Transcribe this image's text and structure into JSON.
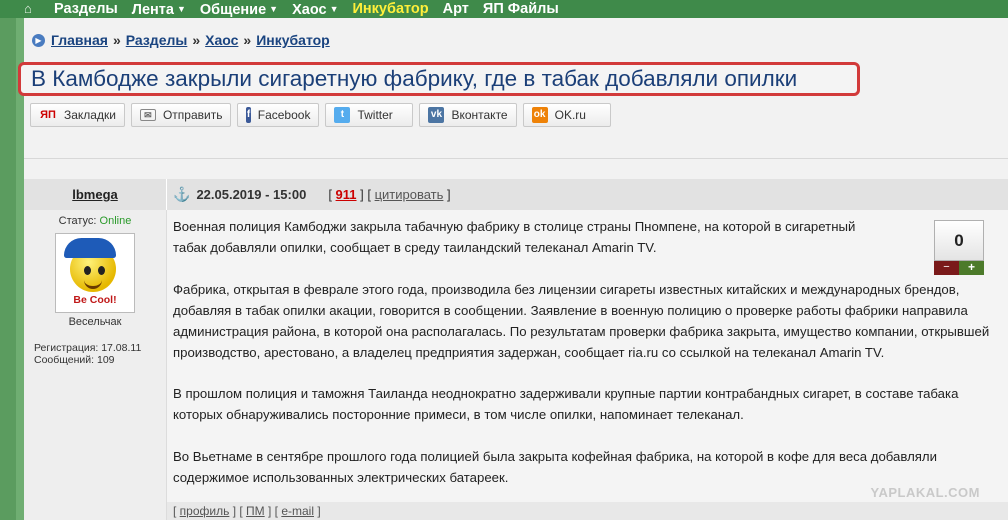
{
  "topnav": {
    "home_icon": "home-icon",
    "items": [
      {
        "label": "Разделы",
        "caret": false
      },
      {
        "label": "Лента",
        "caret": true
      },
      {
        "label": "Общение",
        "caret": true
      },
      {
        "label": "Хаос",
        "caret": true
      },
      {
        "label": "Инкубатор",
        "caret": false,
        "active": true
      },
      {
        "label": "Арт",
        "caret": false
      },
      {
        "label": "ЯП Файлы",
        "caret": false
      }
    ]
  },
  "breadcrumb": {
    "items": [
      "Главная",
      "Разделы",
      "Хаос",
      "Инкубатор"
    ],
    "separator": "»"
  },
  "title": "В Камбодже закрыли сигаретную фабрику, где в табак добавляли опилки",
  "share": [
    {
      "label": "Закладки",
      "icon": "yap-bookmarks-icon",
      "glyph": "ЯП"
    },
    {
      "label": "Отправить",
      "icon": "mail-icon",
      "glyph": "✉"
    },
    {
      "label": "Facebook",
      "icon": "facebook-icon",
      "glyph": "f"
    },
    {
      "label": "Twitter",
      "icon": "twitter-icon",
      "glyph": "t"
    },
    {
      "label": "Вконтакте",
      "icon": "vk-icon",
      "glyph": "vk"
    },
    {
      "label": "OK.ru",
      "icon": "ok-icon",
      "glyph": "ok"
    }
  ],
  "post": {
    "author": {
      "nick": "lbmega",
      "status_label": "Статус:",
      "status_value": "Online",
      "avatar_sign": "Be Cool!",
      "rank": "Весельчак",
      "registration": "Регистрация: 17.08.11",
      "messages": "Сообщений: 109"
    },
    "date": "22.05.2019 - 15:00",
    "count": "911",
    "quote": "цитировать",
    "paragraphs": [
      "Военная полиция Камбоджи закрыла табачную фабрику в столице страны Пномпене, на которой в сигаретный табак добавляли опилки, сообщает в среду таиландский телеканал Amarin TV.",
      "Фабрика, открытая в феврале этого года, производила без лицензии сигареты известных китайских и международных брендов, добавляя в табак опилки акации, говорится в сообщении. Заявление в военную полицию о проверке работы фабрики направила администрация района, в которой она располагалась. По результатам проверки фабрика закрыта, имущество компании, открывшей производство, арестовано, а владелец предприятия задержан, сообщает ria.ru со ссылкой на телеканал Amarin TV.",
      "В прошлом полиция и таможня Таиланда неоднократно задерживали крупные партии контрабандных сигарет, в составе табака которых обнаруживались посторонние примеси, в том числе опилки, напоминает телеканал.",
      "Во Вьетнаме в сентябре прошлого года полицией была закрыта кофейная фабрика, на которой в кофе для веса добавляли содержимое использованных электрических батареек."
    ],
    "rating": {
      "value": "0",
      "minus": "−",
      "plus": "+"
    },
    "footer": [
      "профиль",
      "ПМ",
      "e-mail"
    ]
  },
  "watermark": "YAPLAKAL.COM",
  "colors": {
    "nav_bg": "#3f8a4a",
    "active_nav": "#ffef3a",
    "title": "#1b3f78",
    "title_border": "#d23a3a"
  }
}
